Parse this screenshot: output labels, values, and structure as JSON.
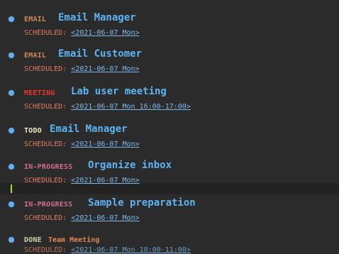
{
  "colors": {
    "background": "#2b2b2b",
    "bullet": "#63aef2",
    "title": "#5cb4f2",
    "scheduled_label": "#e07a5f",
    "date_link": "#7eb8ea",
    "keyword_email": "#d08752",
    "keyword_meeting": "#e8362b",
    "keyword_todo": "#f0e7c8",
    "keyword_in_progress": "#d06c8c",
    "keyword_done": "#c9d7a5",
    "cursor": "#a6e22e"
  },
  "entries": [
    {
      "keyword": "EMAIL",
      "title": "Email Manager",
      "scheduled_label": "SCHEDULED:",
      "date": "<2021-06-07 Mon>"
    },
    {
      "keyword": "EMAIL",
      "title": "Email Customer",
      "scheduled_label": "SCHEDULED:",
      "date": "<2021-06-07 Mon>"
    },
    {
      "keyword": "MEETING",
      "title": "Lab user meeting",
      "scheduled_label": "SCHEDULED:",
      "date": "<2021-06-07 Mon 16:00-17:00>"
    },
    {
      "keyword": "TODO",
      "title": "Email Manager",
      "scheduled_label": "SCHEDULED:",
      "date": "<2021-06-07 Mon>"
    },
    {
      "keyword": "IN-PROGRESS",
      "title": "Organize inbox",
      "scheduled_label": "SCHEDULED:",
      "date": "<2021-06-07 Mon>"
    },
    {
      "keyword": "IN-PROGRESS",
      "title": "Sample preparation",
      "scheduled_label": "SCHEDULED:",
      "date": "<2021-06-07 Mon>"
    },
    {
      "keyword": "DONE",
      "title": "Team Meeting",
      "scheduled_label": "SCHEDULED:",
      "date": "<2021-06-07 Mon 10:00-11:00>"
    }
  ]
}
